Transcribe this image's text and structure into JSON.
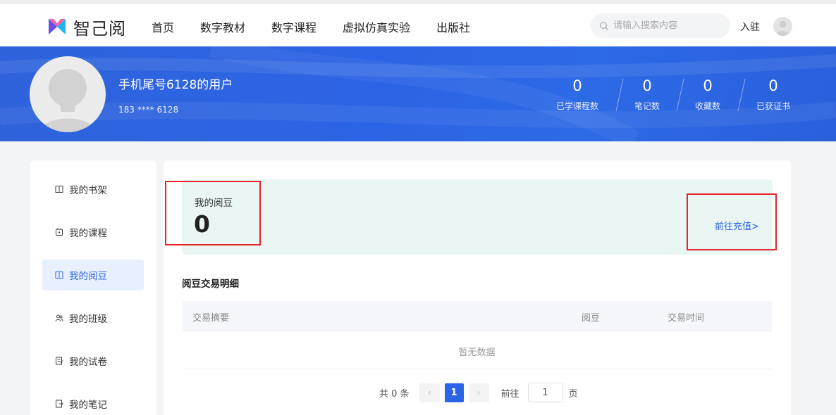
{
  "header": {
    "logo_text": "智己阅",
    "nav": [
      "首页",
      "数字教材",
      "数字课程",
      "虚拟仿真实验",
      "出版社"
    ],
    "search_placeholder": "请输入搜索内容",
    "join_label": "入驻"
  },
  "profile": {
    "username": "手机尾号6128的用户",
    "phone": "183 **** 6128",
    "stats": [
      {
        "value": "0",
        "label": "已学课程数"
      },
      {
        "value": "0",
        "label": "笔记数"
      },
      {
        "value": "0",
        "label": "收藏数"
      },
      {
        "value": "0",
        "label": "已获证书"
      }
    ]
  },
  "sidebar": {
    "items": [
      {
        "label": "我的书架",
        "icon": "book-icon"
      },
      {
        "label": "我的课程",
        "icon": "course-icon"
      },
      {
        "label": "我的阅豆",
        "icon": "open-book-icon",
        "active": true
      },
      {
        "label": "我的班级",
        "icon": "users-icon"
      },
      {
        "label": "我的试卷",
        "icon": "exam-icon"
      },
      {
        "label": "我的笔记",
        "icon": "note-icon"
      }
    ]
  },
  "beans": {
    "label": "我的阅豆",
    "value": "0",
    "recharge_label": "前往充值>"
  },
  "transactions": {
    "title": "阅豆交易明细",
    "columns": [
      "交易摘要",
      "阅豆",
      "交易时间"
    ],
    "empty_text": "暂无数据"
  },
  "pagination": {
    "total_text": "共 0 条",
    "prev": "‹",
    "current_page": "1",
    "next": "›",
    "goto_label": "前往",
    "page_input_value": "1",
    "page_suffix": "页"
  },
  "colors": {
    "accent": "#2b64e4",
    "highlight": "#e6242b",
    "bean_card_bg": "#eaf6f4"
  }
}
